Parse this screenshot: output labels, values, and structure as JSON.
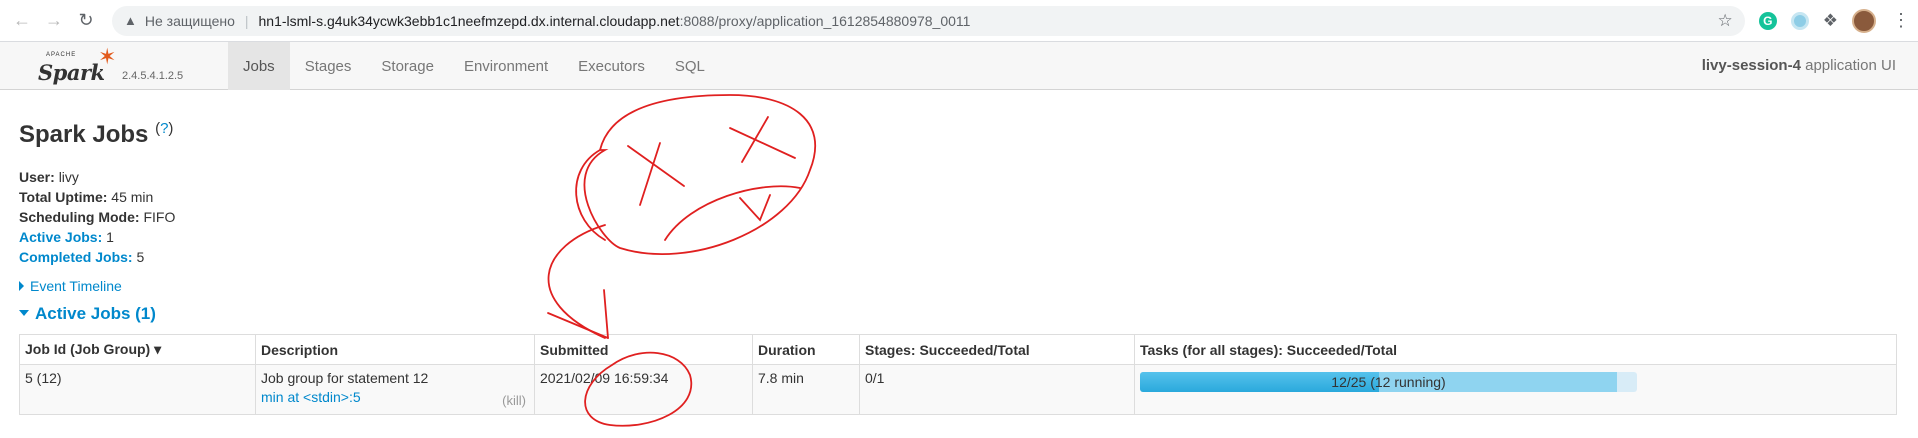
{
  "browser": {
    "back_icon": "arrow-left-icon",
    "forward_icon": "arrow-right-icon",
    "reload_icon": "reload-icon",
    "security_label": "Не защищено",
    "url_host": "hn1-lsml-s.g4uk34ycwk3ebb1c1neefmzepd.dx.internal.cloudapp.net",
    "url_rest": ":8088/proxy/application_1612854880978_0011"
  },
  "navbar": {
    "brand_word": "Spark",
    "brand_apache": "APACHE",
    "version": "2.4.5.4.1.2.5",
    "tabs": [
      {
        "label": "Jobs",
        "active": true
      },
      {
        "label": "Stages"
      },
      {
        "label": "Storage"
      },
      {
        "label": "Environment"
      },
      {
        "label": "Executors"
      },
      {
        "label": "SQL"
      }
    ],
    "app_name": "livy-session-4",
    "app_suffix": " application UI"
  },
  "page": {
    "title": "Spark Jobs",
    "help": "?",
    "user_label": "User:",
    "user_value": "livy",
    "uptime_label": "Total Uptime:",
    "uptime_value": "45 min",
    "scheduling_label": "Scheduling Mode:",
    "scheduling_value": "FIFO",
    "active_jobs_label": "Active Jobs:",
    "active_jobs_value": "1",
    "completed_jobs_label": "Completed Jobs:",
    "completed_jobs_value": "5",
    "event_timeline": "Event Timeline",
    "active_jobs_heading": "Active Jobs (1)"
  },
  "table": {
    "headers": [
      "Job Id (Job Group) ▾",
      "Description",
      "Submitted",
      "Duration",
      "Stages: Succeeded/Total",
      "Tasks (for all stages): Succeeded/Total"
    ],
    "rows": [
      {
        "job_id": "5 (12)",
        "description": "Job group for statement 12",
        "description_link": "min at <stdin>:5",
        "kill": "(kill)",
        "submitted": "2021/02/09 16:59:34",
        "duration": "7.8 min",
        "stages": "0/1",
        "tasks_text": "12/25 (12 running)",
        "tasks_succeeded": 12,
        "tasks_running": 12,
        "tasks_total": 25
      }
    ]
  },
  "colors": {
    "accent": "#0088cc",
    "annotation": "#e02020",
    "spark_orange": "#e25a1c"
  }
}
